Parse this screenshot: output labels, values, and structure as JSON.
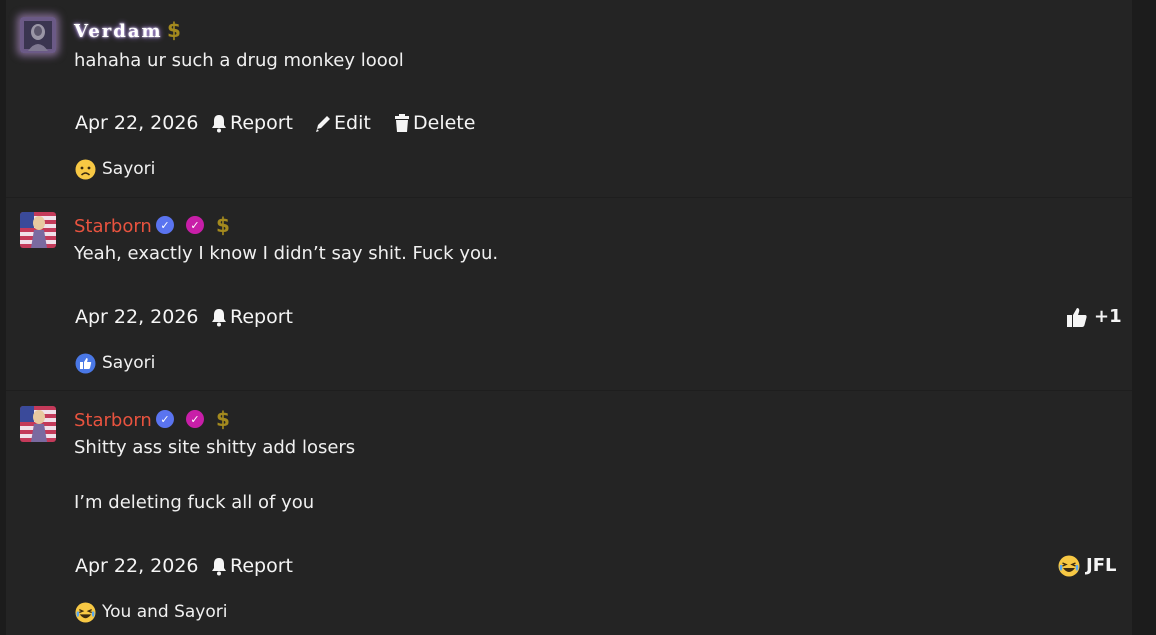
{
  "posts": [
    {
      "author": "Verdam",
      "dollar": "$",
      "body": [
        "hahaha ur such a drug monkey loool"
      ],
      "date": "Apr 22, 2026",
      "actions": [
        "Report",
        "Edit",
        "Delete"
      ],
      "reaction_users": "Sayori",
      "reaction_icon": "sad-face-icon"
    },
    {
      "author": "Starborn",
      "dollar": "$",
      "body": [
        "Yeah, exactly I know I didn’t say shit. Fuck you."
      ],
      "date": "Apr 22, 2026",
      "actions": [
        "Report"
      ],
      "reaction_summary": "+1",
      "reaction_summary_icon": "thumbs-up-icon",
      "reaction_users": "Sayori",
      "reaction_icon": "like-icon"
    },
    {
      "author": "Starborn",
      "dollar": "$",
      "body": [
        "Shitty ass site shitty add losers",
        "I’m deleting fuck all of you"
      ],
      "date": "Apr 22, 2026",
      "actions": [
        "Report"
      ],
      "reaction_summary": "JFL",
      "reaction_summary_icon": "crying-laughing-icon",
      "reaction_users": "You and Sayori",
      "reaction_icon": "crying-laughing-icon"
    }
  ],
  "colors": {
    "starborn_name": "#e8533f",
    "verified_badge": "#5a74f0",
    "pink_badge": "#c81ea8",
    "dollar": "#a48a1e",
    "background": "#242424"
  }
}
